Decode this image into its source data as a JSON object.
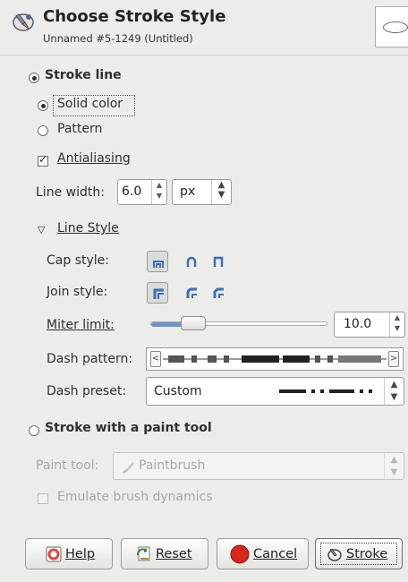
{
  "header": {
    "title": "Choose Stroke Style",
    "subtitle": "Unnamed #5-1249 (Untitled)"
  },
  "stroke_line": {
    "label": "Stroke line",
    "selected": true,
    "solid_color_label": "Solid color",
    "pattern_label": "Pattern",
    "fill_choice": "Solid color",
    "antialiasing_label": "Antialiasing",
    "antialiasing_checked": true,
    "line_width_label": "Line width:",
    "line_width_value": "6.0",
    "unit_value": "px",
    "line_style_label": "Line Style",
    "cap_style_label": "Cap style:",
    "join_style_label": "Join style:",
    "miter_limit_label": "Miter limit:",
    "miter_limit_value": "10.0",
    "miter_limit_fraction": 0.2,
    "dash_pattern_label": "Dash pattern:",
    "dash_preset_label": "Dash preset:",
    "dash_preset_value": "Custom"
  },
  "stroke_paint": {
    "label": "Stroke with a paint tool",
    "selected": false,
    "paint_tool_label": "Paint tool:",
    "paint_tool_value": "Paintbrush",
    "emulate_label": "Emulate brush dynamics",
    "emulate_checked": false
  },
  "buttons": {
    "help": "Help",
    "reset": "Reset",
    "cancel": "Cancel",
    "stroke": "Stroke"
  },
  "colors": {
    "accent": "#6f93c6",
    "cancel_red": "#d9261c",
    "help_red": "#e0493e"
  }
}
